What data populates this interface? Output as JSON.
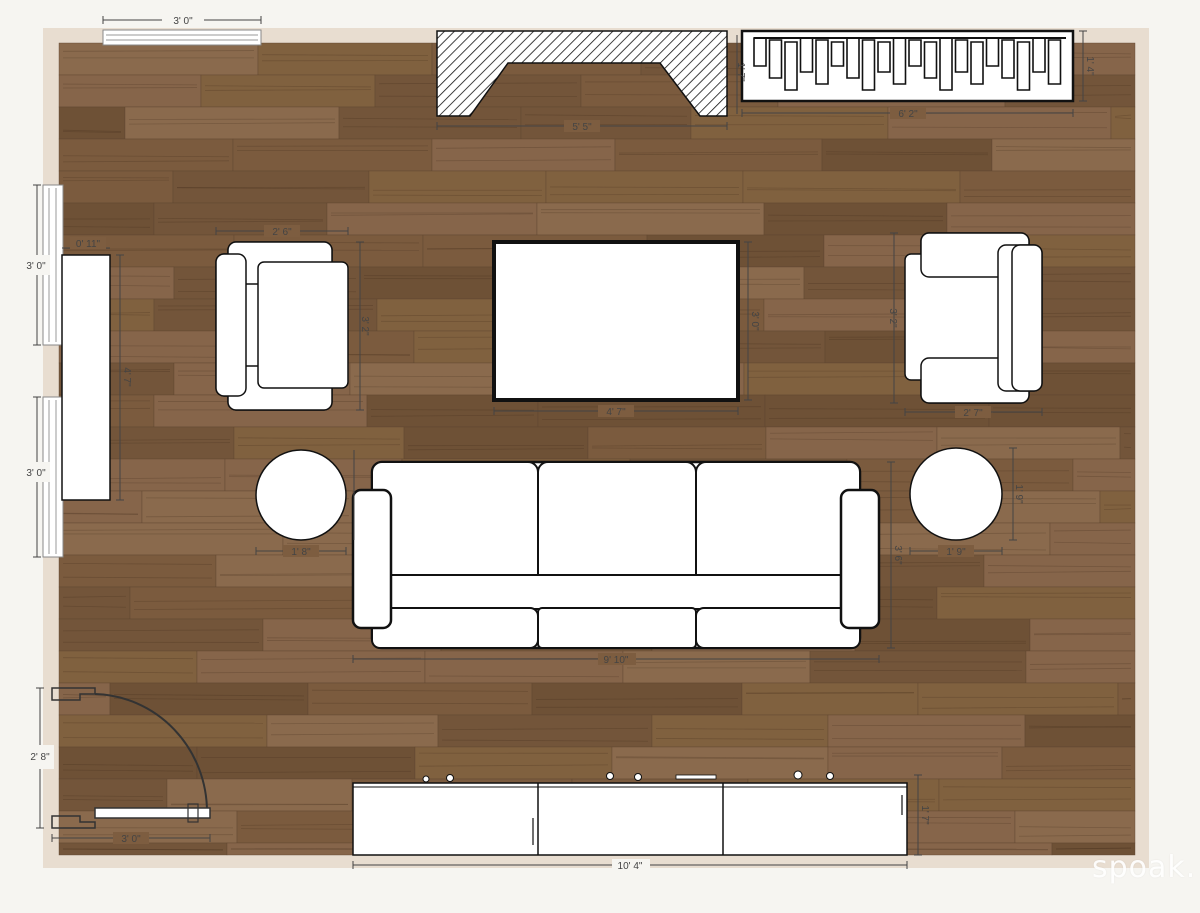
{
  "brand": {
    "logo_text": "spoak."
  },
  "colors": {
    "wall": "#e8ddd0",
    "floor": "#7d5d40",
    "furniture": "#ffffff",
    "outline": "#111111",
    "dimension": "#444444",
    "background": "#f6f5f1"
  },
  "dimensions": {
    "window_top": "3' 0\"",
    "fireplace_width": "5' 5\"",
    "radiator_width": "6' 2\"",
    "radiator_depth": "1' 4\"",
    "fireplace_depth": "1' 7\"",
    "window_left_upper": "3' 0\"",
    "window_left_lower": "3' 0\"",
    "console_depth": "0' 11\"",
    "console_length": "4' 7\"",
    "armchair_left_width": "2' 6\"",
    "armchair_left_depth": "3' 2\"",
    "ottoman_width": "4' 7\"",
    "ottoman_depth": "3' 0\"",
    "armchair_right_width": "2' 7\"",
    "armchair_right_depth": "3' 2\"",
    "side_table_left": "1' 8\"",
    "side_table_right_width": "1' 9\"",
    "side_table_right_depth": "1' 9\"",
    "sofa_width": "9' 10\"",
    "sofa_depth": "3' 6\"",
    "door_height": "2' 8\"",
    "door_width": "3' 0\"",
    "media_width": "10' 4\"",
    "media_depth": "1' 7\""
  }
}
